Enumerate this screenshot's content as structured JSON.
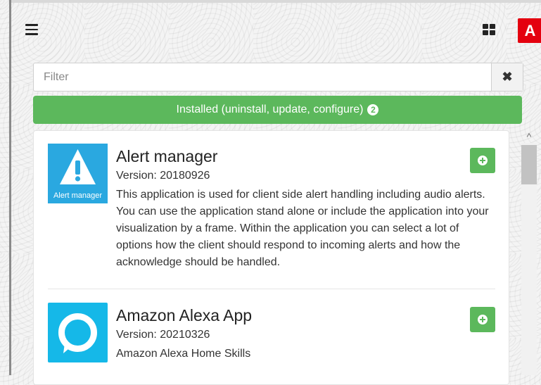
{
  "app_logo": "A",
  "icons": {
    "menu": "hamburger-menu-icon",
    "grid": "grid-view-icon",
    "clear": "close-icon",
    "add": "plus-circle-icon",
    "alert": "warning-triangle-icon",
    "alexa": "alexa-ring-icon"
  },
  "colors": {
    "accent_green": "#5cb85c",
    "logo_red": "#e4000f",
    "alert_icon_blue": "#2aa8e0",
    "alexa_icon_blue": "#15b8e8"
  },
  "filter": {
    "placeholder": "Filter",
    "value": "",
    "clear_label": "✖"
  },
  "installed_bar": {
    "label": "Installed (uninstall, update, configure)",
    "count": "2"
  },
  "apps": [
    {
      "title": "Alert manager",
      "version": "Version: 20180926",
      "icon_caption": "Alert manager",
      "description": "This application is used for client side alert handling including audio alerts. You can use the application stand alone or include the application into your visualization by a frame. Within the application you can select a lot of options how the client should respond to incoming alerts and how the acknowledge should be handled."
    },
    {
      "title": "Amazon Alexa App",
      "version": "Version: 20210326",
      "description": "Amazon Alexa Home Skills"
    }
  ],
  "scrollbar": {
    "up_arrow": "^"
  }
}
